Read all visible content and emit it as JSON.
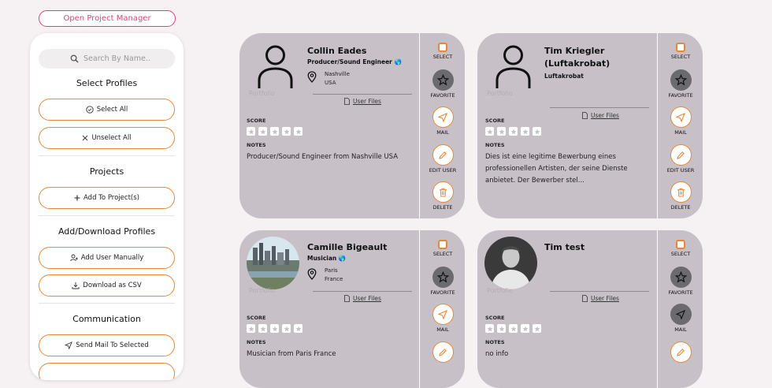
{
  "open_project_manager": "Open Project Manager",
  "sidebar": {
    "search_placeholder": "Search By Name..",
    "select_profiles_title": "Select Profiles",
    "select_all": "Select All",
    "unselect_all": "Unselect All",
    "projects_title": "Projects",
    "add_to_projects": "Add To Project(s)",
    "add_download_title": "Add/Download Profiles",
    "add_user_manually": "Add User Manually",
    "download_csv": "Download as CSV",
    "communication_title": "Communication",
    "send_mail": "Send Mail To Selected"
  },
  "labels": {
    "select": "SELECT",
    "favorite": "FAVORITE",
    "mail": "MAIL",
    "edit_user": "EDIT USER",
    "delete": "DELETE",
    "score": "SCORE",
    "notes": "NOTES",
    "user_files": "User Files",
    "watermark": "Portfolio"
  },
  "cards": [
    {
      "name": "Collin Eades",
      "subtitle": "Producer/Sound Engineer 🌎",
      "city": "Nashville",
      "country": "USA",
      "notes": "Producer/Sound Engineer from Nashville USA"
    },
    {
      "name": "Tim Kriegler (Luftakrobat)",
      "subtitle": "Luftakrobat",
      "notes": "Dies ist eine legitime Bewerbung eines professionellen Artisten, der seine Dienste anbietet. Der Bewerber stel..."
    },
    {
      "name": "Camille Bigeault",
      "subtitle": "Musician 🌎",
      "city": "Paris",
      "country": "France",
      "notes": "Musician from Paris France"
    },
    {
      "name": "Tim test",
      "notes": "no info"
    }
  ],
  "colors": {
    "accent": "#e8873a",
    "pink": "#e0407a",
    "card_bg": "#c8c0c7",
    "dark_circle": "#6b6b6f"
  }
}
